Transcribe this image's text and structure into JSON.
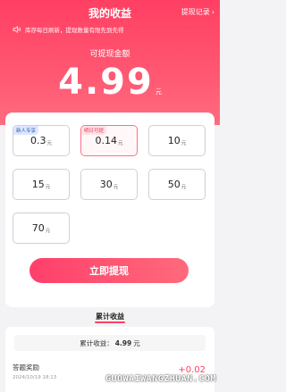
{
  "header": {
    "title": "我的收益",
    "records_label": "提现记录",
    "notice": "库存每日刷新，提现数量有限先到先得"
  },
  "balance": {
    "label": "可提现金额",
    "amount": "4.99",
    "unit": "元"
  },
  "options": [
    {
      "value": "0.3",
      "unit": "元",
      "badge": "新人专享"
    },
    {
      "value": "0.14",
      "unit": "元",
      "badge": "明日可提"
    },
    {
      "value": "10",
      "unit": "元"
    },
    {
      "value": "15",
      "unit": "元"
    },
    {
      "value": "30",
      "unit": "元"
    },
    {
      "value": "50",
      "unit": "元"
    },
    {
      "value": "70",
      "unit": "元"
    }
  ],
  "withdraw_button": "立即提现",
  "earnings_tab": "累计收益",
  "summary": {
    "label": "累计收益：",
    "amount": "4.99",
    "unit": "元"
  },
  "records": [
    {
      "title": "答题奖励",
      "time": "2024/10/19 18:13",
      "amount": "+0.02"
    }
  ],
  "watermark": "GUOWAIWANGZHUAN.COM",
  "colors": {
    "accent": "#ff3f63",
    "badge_blue": "#2a5db0"
  }
}
